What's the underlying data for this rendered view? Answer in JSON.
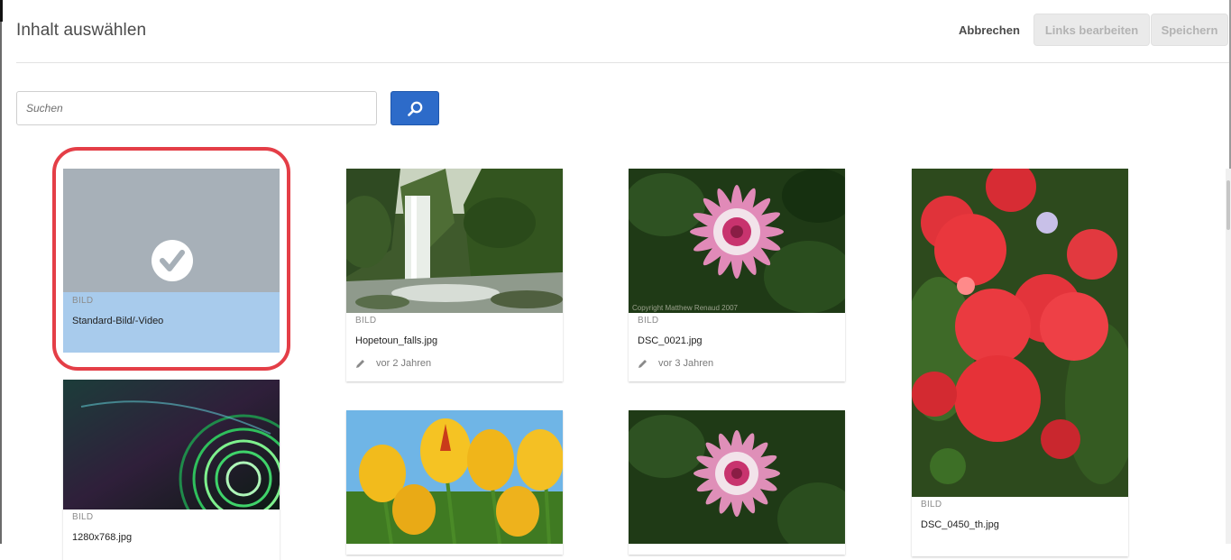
{
  "dialog": {
    "title": "Inhalt auswählen",
    "cancel_label": "Abbrechen",
    "edit_links_label": "Links bearbeiten",
    "save_label": "Speichern"
  },
  "search": {
    "placeholder": "Suchen",
    "button_icon": "search-icon"
  },
  "colors": {
    "accent": "#2d6bc9",
    "selected_bg": "#a8cbec",
    "highlight_ring": "#e43e47"
  },
  "assets": [
    {
      "type": "BILD",
      "name": "Standard-Bild/-Video",
      "selected": true,
      "icon": "checkmark-icon"
    },
    {
      "type": "BILD",
      "name": "Hopetoun_falls.jpg",
      "modified": "vor 2 Jahren",
      "icon": "pencil-icon"
    },
    {
      "type": "BILD",
      "name": "DSC_0021.jpg",
      "modified": "vor 3 Jahren",
      "icon": "pencil-icon"
    },
    {
      "type": "BILD",
      "name": "DSC_0450_th.jpg"
    },
    {
      "type": "BILD",
      "name": "1280x768.jpg"
    },
    {
      "type": "",
      "name": ""
    },
    {
      "type": "",
      "name": ""
    }
  ]
}
